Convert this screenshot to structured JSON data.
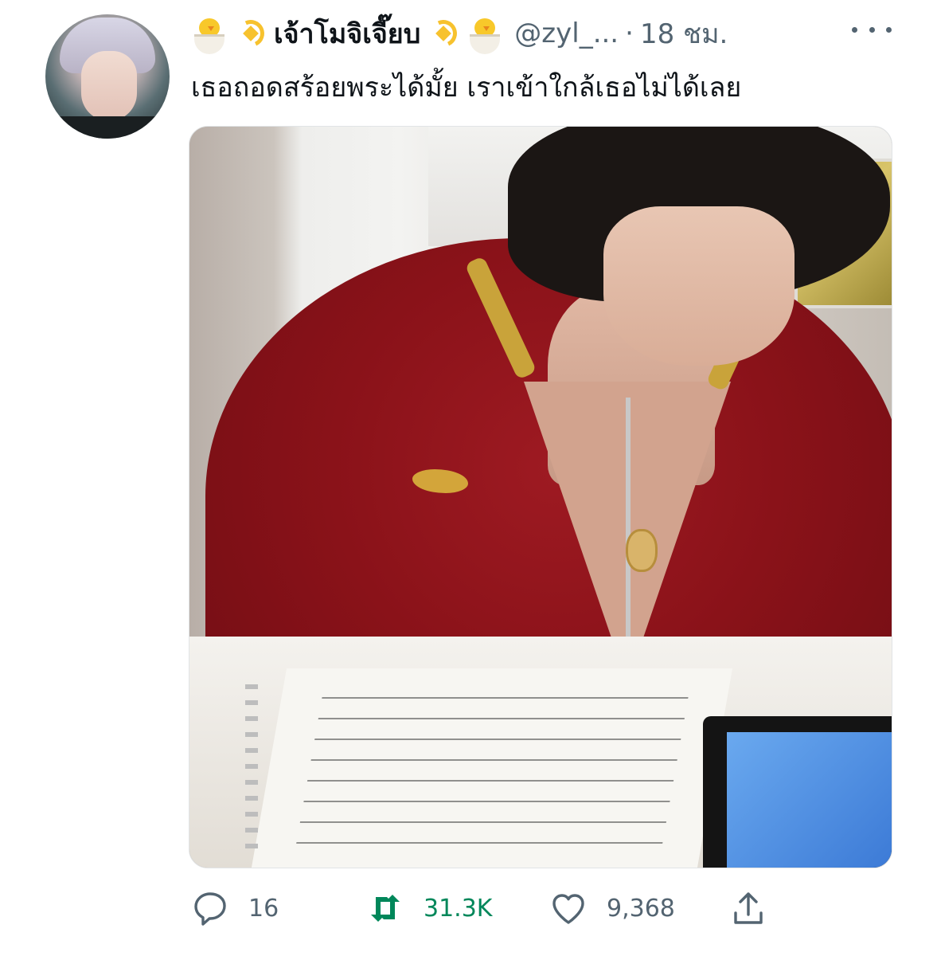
{
  "tweet": {
    "display_name": "เจ้าโมจิเจี๊ยบ",
    "handle": "@zyl_...",
    "separator": "·",
    "time": "18 ชม.",
    "text": "เธอถอดสร้อยพระได้มั้ย เราเข้าใกล้เธอไม่ได้เลย"
  },
  "name_emojis": [
    "hatching-chick",
    "dizzy",
    "dizzy",
    "hatching-chick"
  ],
  "icons": {
    "reply": "reply-icon",
    "retweet": "retweet-icon",
    "like": "heart-icon",
    "share": "share-icon",
    "more": "more-icon"
  },
  "actions": {
    "replies": "16",
    "retweets": "31.3K",
    "likes": "9,368"
  },
  "colors": {
    "text": "#0f1419",
    "muted": "#536471",
    "retweet_active": "#00875a"
  }
}
